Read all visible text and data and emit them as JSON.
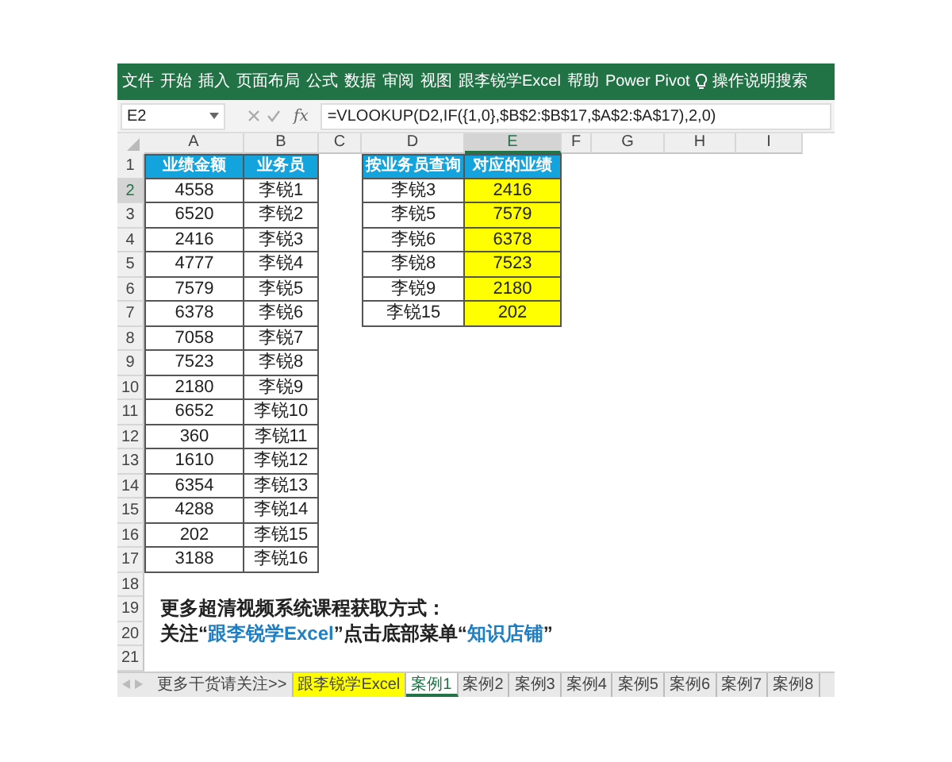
{
  "ribbon": {
    "tabs": [
      "文件",
      "开始",
      "插入",
      "页面布局",
      "公式",
      "数据",
      "审阅",
      "视图",
      "跟李锐学Excel",
      "帮助",
      "Power Pivot"
    ],
    "search": "操作说明搜索"
  },
  "formula_bar": {
    "name_box": "E2",
    "function_label": "fx",
    "formula": "=VLOOKUP(D2,IF({1,0},$B$2:$B$17,$A$2:$A$17),2,0)"
  },
  "columns": [
    {
      "label": "A",
      "selected": false
    },
    {
      "label": "B",
      "selected": false
    },
    {
      "label": "C",
      "selected": false
    },
    {
      "label": "D",
      "selected": false
    },
    {
      "label": "E",
      "selected": true
    },
    {
      "label": "F",
      "selected": false
    },
    {
      "label": "G",
      "selected": false
    },
    {
      "label": "H",
      "selected": false
    },
    {
      "label": "I",
      "selected": false
    }
  ],
  "rows": [
    {
      "label": "1",
      "selected": false
    },
    {
      "label": "2",
      "selected": true
    },
    {
      "label": "3",
      "selected": false
    },
    {
      "label": "4",
      "selected": false
    },
    {
      "label": "5",
      "selected": false
    },
    {
      "label": "6",
      "selected": false
    },
    {
      "label": "7",
      "selected": false
    },
    {
      "label": "8",
      "selected": false
    },
    {
      "label": "9",
      "selected": false
    },
    {
      "label": "10",
      "selected": false
    },
    {
      "label": "11",
      "selected": false
    },
    {
      "label": "12",
      "selected": false
    },
    {
      "label": "13",
      "selected": false
    },
    {
      "label": "14",
      "selected": false
    },
    {
      "label": "15",
      "selected": false
    },
    {
      "label": "16",
      "selected": false
    },
    {
      "label": "17",
      "selected": false
    },
    {
      "label": "18",
      "selected": false
    },
    {
      "label": "19",
      "selected": false
    },
    {
      "label": "20",
      "selected": false
    },
    {
      "label": "21",
      "selected": false
    }
  ],
  "tables": [
    {
      "columns": [
        {
          "header": "业绩金额",
          "highlighted": false
        },
        {
          "header": "业务员",
          "highlighted": false
        }
      ],
      "rows": [
        [
          "4558",
          "李锐1"
        ],
        [
          "6520",
          "李锐2"
        ],
        [
          "2416",
          "李锐3"
        ],
        [
          "4777",
          "李锐4"
        ],
        [
          "7579",
          "李锐5"
        ],
        [
          "6378",
          "李锐6"
        ],
        [
          "7058",
          "李锐7"
        ],
        [
          "7523",
          "李锐8"
        ],
        [
          "2180",
          "李锐9"
        ],
        [
          "6652",
          "李锐10"
        ],
        [
          "360",
          "李锐11"
        ],
        [
          "1610",
          "李锐12"
        ],
        [
          "6354",
          "李锐13"
        ],
        [
          "4288",
          "李锐14"
        ],
        [
          "202",
          "李锐15"
        ],
        [
          "3188",
          "李锐16"
        ]
      ]
    },
    {
      "columns": [
        {
          "header": "按业务员查询",
          "highlighted": false
        },
        {
          "header": "对应的业绩",
          "highlighted": true
        }
      ],
      "rows": [
        [
          "李锐3",
          "2416"
        ],
        [
          "李锐5",
          "7579"
        ],
        [
          "李锐6",
          "6378"
        ],
        [
          "李锐8",
          "7523"
        ],
        [
          "李锐9",
          "2180"
        ],
        [
          "李锐15",
          "202"
        ]
      ]
    }
  ],
  "notes": [
    {
      "segments": [
        {
          "text": "更多超清视频系统课程获取方式：",
          "accent": false
        }
      ]
    },
    {
      "segments": [
        {
          "text": "关注“",
          "accent": false
        },
        {
          "text": "跟李锐学Excel",
          "accent": true
        },
        {
          "text": "”点击底部菜单“",
          "accent": false
        },
        {
          "text": "知识店铺",
          "accent": true
        },
        {
          "text": "”",
          "accent": false
        }
      ]
    }
  ],
  "sheet_tabs": [
    {
      "label": "更多干货请关注>>",
      "selected": false,
      "highlighted": false
    },
    {
      "label": "跟李锐学Excel",
      "selected": false,
      "highlighted": true
    },
    {
      "label": "案例1",
      "selected": true,
      "highlighted": false
    },
    {
      "label": "案例2",
      "selected": false,
      "highlighted": false
    },
    {
      "label": "案例3",
      "selected": false,
      "highlighted": false
    },
    {
      "label": "案例4",
      "selected": false,
      "highlighted": false
    },
    {
      "label": "案例5",
      "selected": false,
      "highlighted": false
    },
    {
      "label": "案例6",
      "selected": false,
      "highlighted": false
    },
    {
      "label": "案例7",
      "selected": false,
      "highlighted": false
    },
    {
      "label": "案例8",
      "selected": false,
      "highlighted": false
    }
  ]
}
